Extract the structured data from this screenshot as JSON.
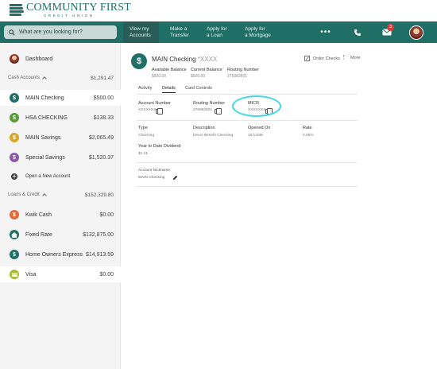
{
  "brand": {
    "name": "COMMUNITY FIRST",
    "sub": "CREDIT UNION",
    "color": "#1f6f66"
  },
  "search": {
    "placeholder": "What are you looking for?"
  },
  "nav": [
    {
      "line1": "View my",
      "line2": "Accounts"
    },
    {
      "line1": "Make a",
      "line2": "Transfer"
    },
    {
      "line1": "Apply for",
      "line2": "a Loan"
    },
    {
      "line1": "Apply for",
      "line2": "a Mortgage"
    }
  ],
  "nav_icons": {
    "more": "more-dots-icon",
    "phone": "phone-icon",
    "mail": "mail-icon",
    "mail_badge": "3"
  },
  "sidebar": {
    "dashboard": "Dashboard",
    "cash_section": {
      "label": "Cash Accounts",
      "amount": "$1,291.47"
    },
    "cash_accounts": [
      {
        "name": "MAIN Checking",
        "amount": "$500.00",
        "color": "#1f6f66"
      },
      {
        "name": "HSA CHECKING",
        "amount": "$138.33",
        "color": "#5a9a3a"
      },
      {
        "name": "MAIN Savings",
        "amount": "$2,065.49",
        "color": "#d8a72a"
      },
      {
        "name": "Special Savings",
        "amount": "$1,520.37",
        "color": "#8a5aa8"
      }
    ],
    "open_new": "Open a New Account",
    "loans_section": {
      "label": "Loans & Credit",
      "amount": "$152,329.80"
    },
    "loan_accounts": [
      {
        "name": "Kwik Cash",
        "amount": "$0.00",
        "color": "#e06a3a"
      },
      {
        "name": "Fixed Rate",
        "amount": "$132,875.00",
        "color": "#1f6f66"
      },
      {
        "name": "Home Owners Express",
        "amount": "$14,913.59",
        "color": "#1f6f66"
      },
      {
        "name": "Visa",
        "amount": "$0.00",
        "color": "#a8b83a"
      }
    ]
  },
  "account": {
    "title": "MAIN Checking",
    "mask": "*XXXX",
    "order_checks": "Order Checks",
    "more": "More",
    "balances": [
      {
        "label": "Available Balance",
        "value": "$500.00"
      },
      {
        "label": "Current Balance",
        "value": "$500.00"
      },
      {
        "label": "Routing Number",
        "value": "275982801"
      }
    ],
    "tabs": [
      "Activity",
      "Details",
      "Card Controls"
    ],
    "row1": [
      {
        "label": "Account Number",
        "value": "XXXXXXX"
      },
      {
        "label": "Routing Number",
        "value": "275982801"
      },
      {
        "label": "MICR",
        "value": "XXXXXXX"
      }
    ],
    "row2": [
      {
        "label": "Type",
        "value": "Checking"
      },
      {
        "label": "Description",
        "value": "Direct Benefit Checking"
      },
      {
        "label": "Opened On",
        "value": "10/14/88"
      },
      {
        "label": "Rate",
        "value": "0.05%"
      }
    ],
    "ytd": {
      "label": "Year to Date Dividend",
      "value": "$1.21"
    },
    "nickname": {
      "label": "Account Nickname",
      "value": "MAIN Checking"
    }
  }
}
